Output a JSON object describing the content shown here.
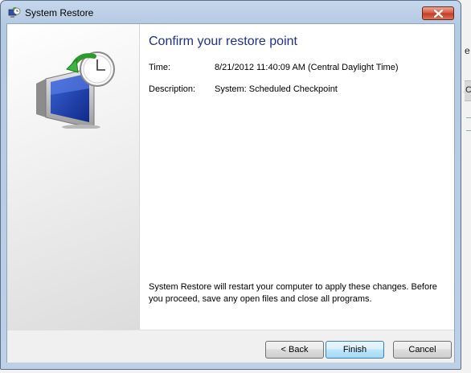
{
  "window": {
    "title": "System Restore"
  },
  "page": {
    "heading": "Confirm your restore point",
    "details": [
      {
        "label": "Time:",
        "value": "8/21/2012 11:40:09 AM (Central Daylight Time)"
      },
      {
        "label": "Description:",
        "value": "System: Scheduled Checkpoint"
      }
    ],
    "notice": "System Restore will restart your computer to apply these changes. Before you proceed, save any open files and close all programs."
  },
  "buttons": {
    "back": "< Back",
    "finish": "Finish",
    "cancel": "Cancel"
  },
  "background": {
    "glyph_top": "e",
    "glyph_mid": "C"
  },
  "icons": {
    "app": "system-restore-icon",
    "hero": "restore-monitor-clock-icon",
    "close": "close-icon"
  },
  "colors": {
    "heading": "#1e3287",
    "close_button": "#c23b20",
    "default_button_border": "#3c7fb1"
  }
}
